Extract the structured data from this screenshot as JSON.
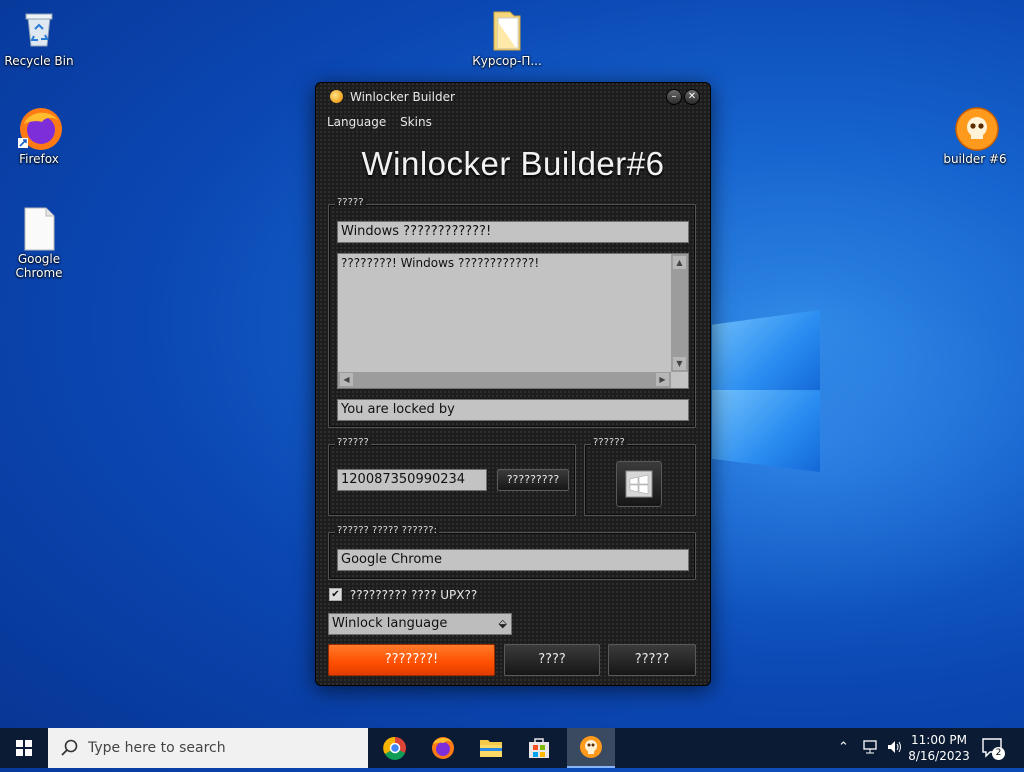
{
  "desktop": {
    "icons": [
      {
        "label": "Recycle Bin",
        "icon": "recycle-bin-icon"
      },
      {
        "label": "Firefox",
        "icon": "firefox-icon"
      },
      {
        "label": "Google Chrome",
        "icon": "blank-file-icon"
      },
      {
        "label": "Курсор-П...",
        "icon": "folder-icon"
      },
      {
        "label": "builder #6",
        "icon": "skull-icon"
      }
    ]
  },
  "window": {
    "title": "Winlocker Builder",
    "menu": [
      "Language",
      "Skins"
    ],
    "heading": "Winlocker Builder#6",
    "group_message": {
      "label": "?????",
      "title_value": "Windows ????????????!",
      "body_value": "????????! Windows ????????????!",
      "footer_value": "You are locked by"
    },
    "group_code": {
      "label": "??????",
      "code_value": "120087350990234",
      "button_label": "?????????"
    },
    "group_icon": {
      "label": "??????"
    },
    "group_target": {
      "label": "?????? ????? ??????:",
      "value": "Google Chrome"
    },
    "checkbox": {
      "label": "????????? ???? UPX??",
      "checked": true
    },
    "language_select": {
      "value": "Winlock language"
    },
    "buttons": {
      "primary": "???????!",
      "second": "????",
      "third": "?????"
    },
    "colors": {
      "accent": "#ff5a10",
      "window_bg": "#1d1d1d"
    }
  },
  "taskbar": {
    "search_placeholder": "Type here to search",
    "apps": [
      "chrome-icon",
      "firefox-icon",
      "file-explorer-icon",
      "store-icon",
      "skull-icon"
    ],
    "time": "11:00 PM",
    "date": "8/16/2023",
    "notification_count": "2"
  }
}
